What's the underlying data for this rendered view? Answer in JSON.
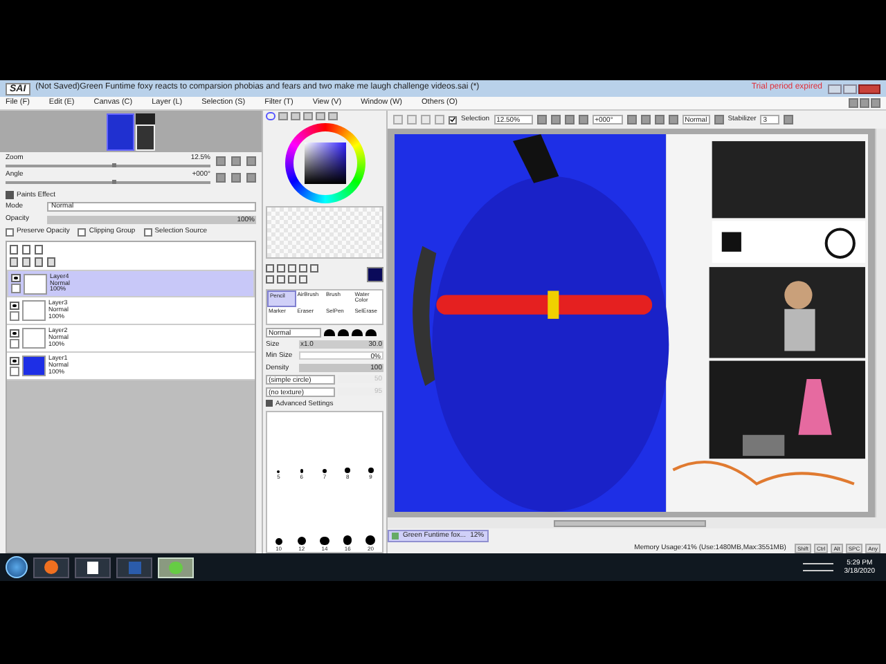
{
  "window": {
    "app": "SAI",
    "title": "(Not Saved)Green Funtime foxy reacts to comparsion phobias and fears and two make me laugh challenge videos.sai (*)",
    "notice": "Trial period expired"
  },
  "menu": [
    "File (F)",
    "Edit (E)",
    "Canvas (C)",
    "Layer (L)",
    "Selection (S)",
    "Filter (T)",
    "View (V)",
    "Window (W)",
    "Others (O)"
  ],
  "navigator": {
    "zoom_label": "Zoom",
    "zoom": "12.5%",
    "angle_label": "Angle",
    "angle": "+000°",
    "sliders": [
      {
        "level": 0.52
      },
      {
        "level": 0.52
      }
    ]
  },
  "layer_panel": {
    "effect": "Paints Effect",
    "mode_label": "Mode",
    "mode": "Normal",
    "opacity_label": "Opacity",
    "opacity": "100%",
    "level": 1,
    "options": [
      {
        "label": "Preserve Opacity",
        "checked": false
      },
      {
        "label": "Clipping Group",
        "checked": false
      },
      {
        "label": "Selection Source",
        "checked": false
      }
    ],
    "layers": [
      {
        "name": "Layer4",
        "mode": "Normal",
        "opacity": "100%",
        "selected": true
      },
      {
        "name": "Layer3",
        "mode": "Normal",
        "opacity": "100%",
        "selected": false
      },
      {
        "name": "Layer2",
        "mode": "Normal",
        "opacity": "100%",
        "selected": false
      },
      {
        "name": "Layer1",
        "mode": "Normal",
        "opacity": "100%",
        "selected": false
      }
    ]
  },
  "tools": {
    "brushes": [
      {
        "label": "Pencil",
        "selected": true
      },
      {
        "label": "AirBrush",
        "selected": false
      },
      {
        "label": "Brush",
        "selected": false
      },
      {
        "label": "Water Color",
        "selected": false
      },
      {
        "label": "Marker",
        "selected": false
      },
      {
        "label": "Eraser",
        "selected": false
      },
      {
        "label": "SelPen",
        "selected": false
      },
      {
        "label": "SelErase",
        "selected": false
      }
    ],
    "blend": "Normal",
    "size_label": "Size",
    "size_scale": "x1.0",
    "size": "30.0",
    "min_size_label": "Min Size",
    "min_size": "0%",
    "density_label": "Density",
    "density": "100",
    "density_slider": {
      "level": 1
    },
    "shape": "(simple circle)",
    "shape_value": "50",
    "texture": "(no texture)",
    "texture_value": "95",
    "advanced": "Advanced Settings",
    "sizes": [
      {
        "label": "5",
        "selected": false
      },
      {
        "label": "6",
        "selected": false
      },
      {
        "label": "7",
        "selected": false
      },
      {
        "label": "8",
        "selected": false
      },
      {
        "label": "9",
        "selected": false
      },
      {
        "label": "10",
        "selected": false
      },
      {
        "label": "12",
        "selected": false
      },
      {
        "label": "14",
        "selected": false
      },
      {
        "label": "16",
        "selected": false
      },
      {
        "label": "20",
        "selected": false
      }
    ]
  },
  "canvas_toolbar": {
    "selection_label": "Selection",
    "selection": true,
    "zoom": "12.50%",
    "angle": "+000°",
    "mode": "Normal",
    "stabilizer_label": "Stabilizer",
    "stabilizer": "3"
  },
  "document_tab": {
    "name": "Green Funtime fox...",
    "zoom": "12%"
  },
  "status_bar": {
    "memory": "Memory Usage:41% (Use:1480MB,Max:3551MB)",
    "keys": [
      "Shift",
      "Ctrl",
      "Alt",
      "SPC",
      "Any"
    ]
  },
  "taskbar": {
    "time": "5:29 PM",
    "date": "3/18/2020"
  }
}
